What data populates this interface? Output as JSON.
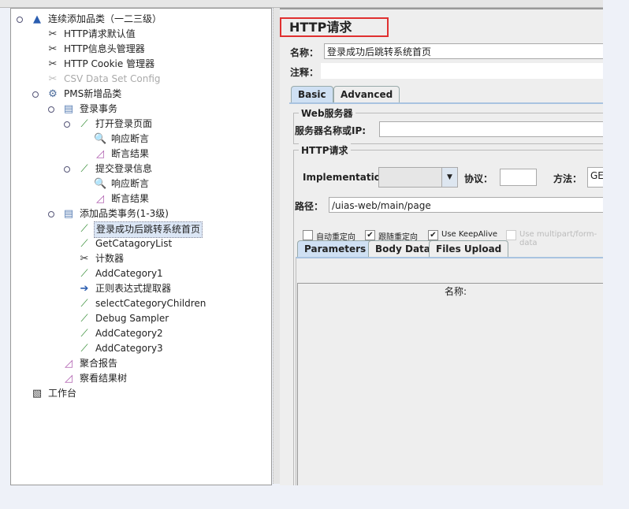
{
  "tree": [
    {
      "label": "连续添加品类（一二三级）",
      "level": 0,
      "icon": "test-plan-flask-icon",
      "toggle": true
    },
    {
      "label": "HTTP请求默认值",
      "level": 1,
      "icon": "config-wrench-icon"
    },
    {
      "label": "HTTP信息头管理器",
      "level": 1,
      "icon": "config-wrench-icon"
    },
    {
      "label": "HTTP Cookie 管理器",
      "level": 1,
      "icon": "config-wrench-icon"
    },
    {
      "label": "CSV Data Set Config",
      "level": 1,
      "icon": "config-wrench-icon",
      "disabled": true
    },
    {
      "label": "PMS新增品类",
      "level": 1,
      "icon": "thread-group-gear-icon",
      "toggle": true
    },
    {
      "label": "登录事务",
      "level": 2,
      "icon": "transaction-controller-icon",
      "toggle": true
    },
    {
      "label": "打开登录页面",
      "level": 3,
      "icon": "sampler-pipette-icon",
      "toggle": true
    },
    {
      "label": "响应断言",
      "level": 4,
      "icon": "assertion-magnifier-icon"
    },
    {
      "label": "断言结果",
      "level": 4,
      "icon": "listener-chart-icon"
    },
    {
      "label": "提交登录信息",
      "level": 3,
      "icon": "sampler-pipette-icon",
      "toggle": true
    },
    {
      "label": "响应断言",
      "level": 4,
      "icon": "assertion-magnifier-icon"
    },
    {
      "label": "断言结果",
      "level": 4,
      "icon": "listener-chart-icon"
    },
    {
      "label": "添加品类事务(1-3级)",
      "level": 2,
      "icon": "transaction-controller-icon",
      "toggle": true
    },
    {
      "label": "登录成功后跳转系统首页",
      "level": 3,
      "icon": "sampler-pipette-icon",
      "selected": true
    },
    {
      "label": "GetCatagoryList",
      "level": 3,
      "icon": "sampler-pipette-icon"
    },
    {
      "label": "计数器",
      "level": 3,
      "icon": "config-wrench-icon"
    },
    {
      "label": "AddCategory1",
      "level": 3,
      "icon": "sampler-pipette-icon"
    },
    {
      "label": "正则表达式提取器",
      "level": 3,
      "icon": "post-processor-arrow-icon"
    },
    {
      "label": "selectCategoryChildren",
      "level": 3,
      "icon": "sampler-pipette-icon"
    },
    {
      "label": "Debug Sampler",
      "level": 3,
      "icon": "sampler-pipette-icon"
    },
    {
      "label": "AddCategory2",
      "level": 3,
      "icon": "sampler-pipette-icon"
    },
    {
      "label": "AddCategory3",
      "level": 3,
      "icon": "sampler-pipette-icon"
    },
    {
      "label": "聚合报告",
      "level": 2,
      "icon": "listener-chart-icon"
    },
    {
      "label": "察看结果树",
      "level": 2,
      "icon": "listener-chart-icon"
    },
    {
      "label": "工作台",
      "level": 0,
      "icon": "workbench-icon"
    }
  ],
  "panel": {
    "title": "HTTP请求",
    "name_label": "名称：",
    "name_value": "登录成功后跳转系统首页",
    "comment_label": "注释：",
    "comment_value": "",
    "tabs": [
      "Basic",
      "Advanced"
    ],
    "web_server_group": "Web服务器",
    "server_label": "服务器名称或IP:",
    "server_value": "",
    "http_group": "HTTP请求",
    "impl_label": "Implementation:",
    "impl_value": "",
    "protocol_label": "协议：",
    "protocol_value": "",
    "method_label": "方法：",
    "method_value": "GET",
    "path_label": "路径：",
    "path_value": "/uias-web/main/page",
    "checkboxes": [
      {
        "label": "自动重定向",
        "checked": false
      },
      {
        "label": "跟随重定向",
        "checked": true
      },
      {
        "label": "Use KeepAlive",
        "checked": true
      },
      {
        "label": "Use multipart/form-data",
        "checked": false,
        "disabled": true
      }
    ],
    "subtabs": [
      "Parameters",
      "Body Data",
      "Files Upload"
    ],
    "table_header": "名称:"
  }
}
